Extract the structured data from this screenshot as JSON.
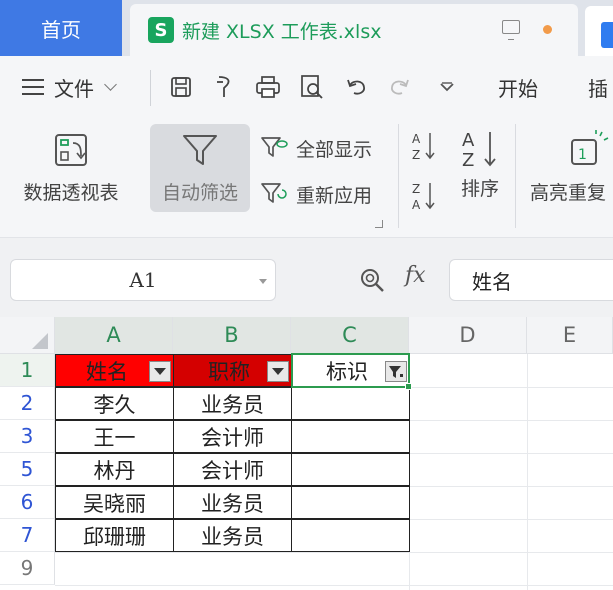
{
  "tabs": {
    "home": "首页",
    "file_icon_letter": "S",
    "file_title": "新建 XLSX 工作表.xlsx"
  },
  "menu": {
    "file": "文件",
    "start": "开始",
    "insert_partial": "插"
  },
  "ribbon": {
    "pivot": "数据透视表",
    "autofilter": "自动筛选",
    "show_all": "全部显示",
    "reapply": "重新应用",
    "sort": "排序",
    "highlight_dup": "高亮重复"
  },
  "formula_bar": {
    "cell_ref": "A1",
    "fx": "fx",
    "value": "姓名"
  },
  "sheet": {
    "columns": [
      "A",
      "B",
      "C",
      "D",
      "E"
    ],
    "row_numbers": [
      "1",
      "2",
      "3",
      "5",
      "6",
      "7",
      "9"
    ],
    "headers": [
      "姓名",
      "职称",
      "标识"
    ],
    "rows": [
      [
        "李久",
        "业务员",
        ""
      ],
      [
        "王一",
        "会计师",
        ""
      ],
      [
        "林丹",
        "会计师",
        ""
      ],
      [
        "吴晓丽",
        "业务员",
        ""
      ],
      [
        "邱珊珊",
        "业务员",
        ""
      ]
    ],
    "colors": {
      "header_a": "#ff0000",
      "header_b": "#d40000",
      "selection": "#2c9b4f"
    }
  }
}
